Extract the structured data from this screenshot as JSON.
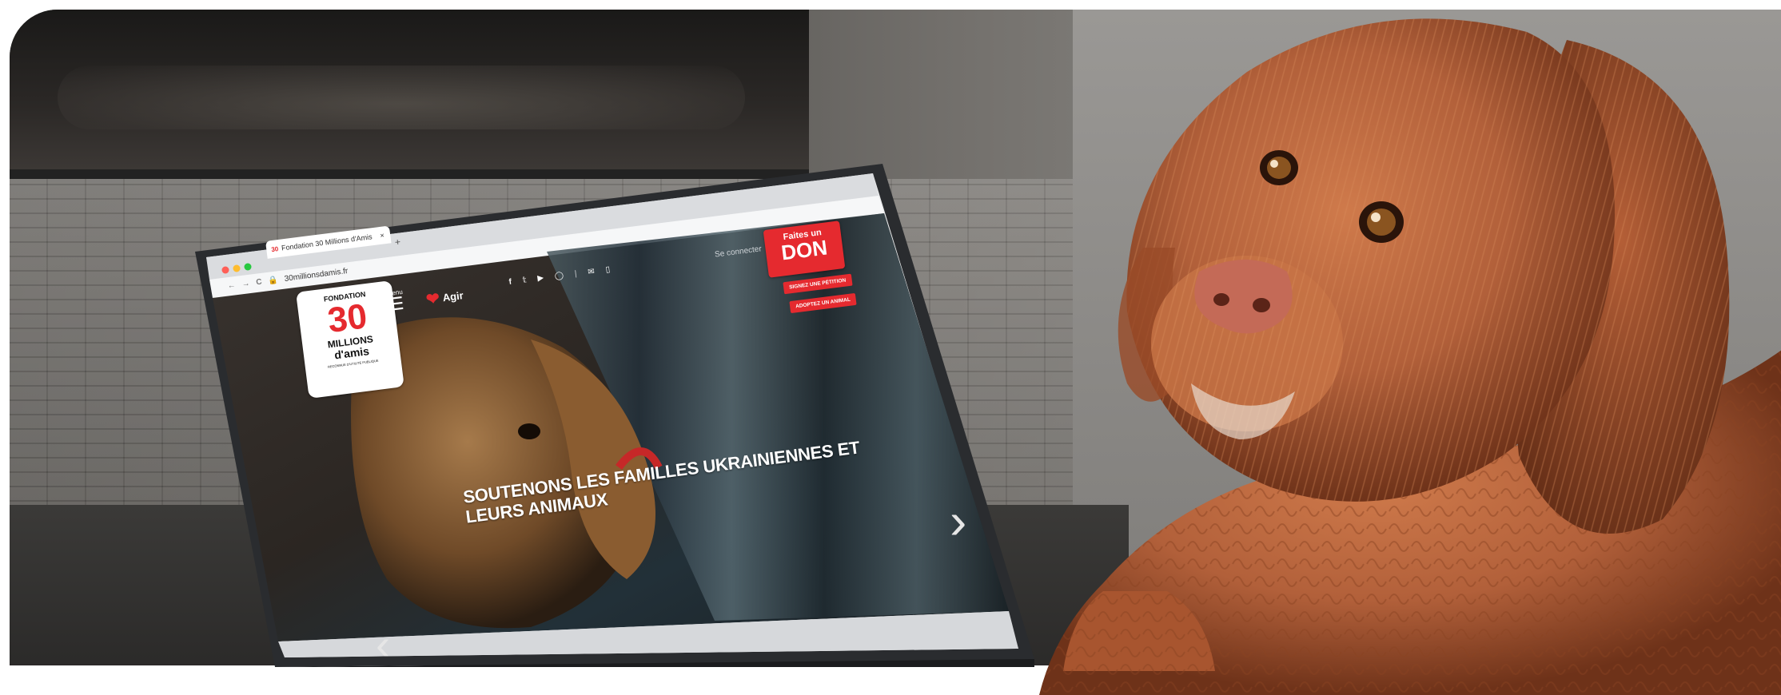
{
  "browser": {
    "tab_title": "Fondation 30 Millions d'Amis",
    "tab_close": "×",
    "new_tab": "+",
    "url": "30millionsdamis.fr",
    "back": "←",
    "forward": "→",
    "reload": "C"
  },
  "website": {
    "logo": {
      "top": "FONDATION",
      "number": "30",
      "line1": "MILLIONS",
      "line2": "d'amis",
      "small": "RECONNUE D'UTILITÉ PUBLIQUE"
    },
    "menu_label": "menu",
    "agir_label": "Agir",
    "social_icons": [
      "facebook-icon",
      "twitter-icon",
      "youtube-icon",
      "instagram-icon"
    ],
    "contact_icons": [
      "mail-icon",
      "phone-icon"
    ],
    "login_label": "Se connecter",
    "don": {
      "line1": "Faites un",
      "line2": "DON"
    },
    "petition_button": "SIGNEZ UNE PÉTITION",
    "adopt_button": "ADOPTEZ UN ANIMAL",
    "hero_title_line1": "SOUTENONS LES FAMILLES UKRAINIENNES ET",
    "hero_title_line2": "LEURS ANIMAUX",
    "next_arrow": "›",
    "prev_arrow": "‹"
  },
  "colors": {
    "brand_red": "#e52a2f",
    "screen_dark": "#1f2326",
    "laptop_body": "#2a2c2f",
    "dog_fur": "#b8623a"
  }
}
